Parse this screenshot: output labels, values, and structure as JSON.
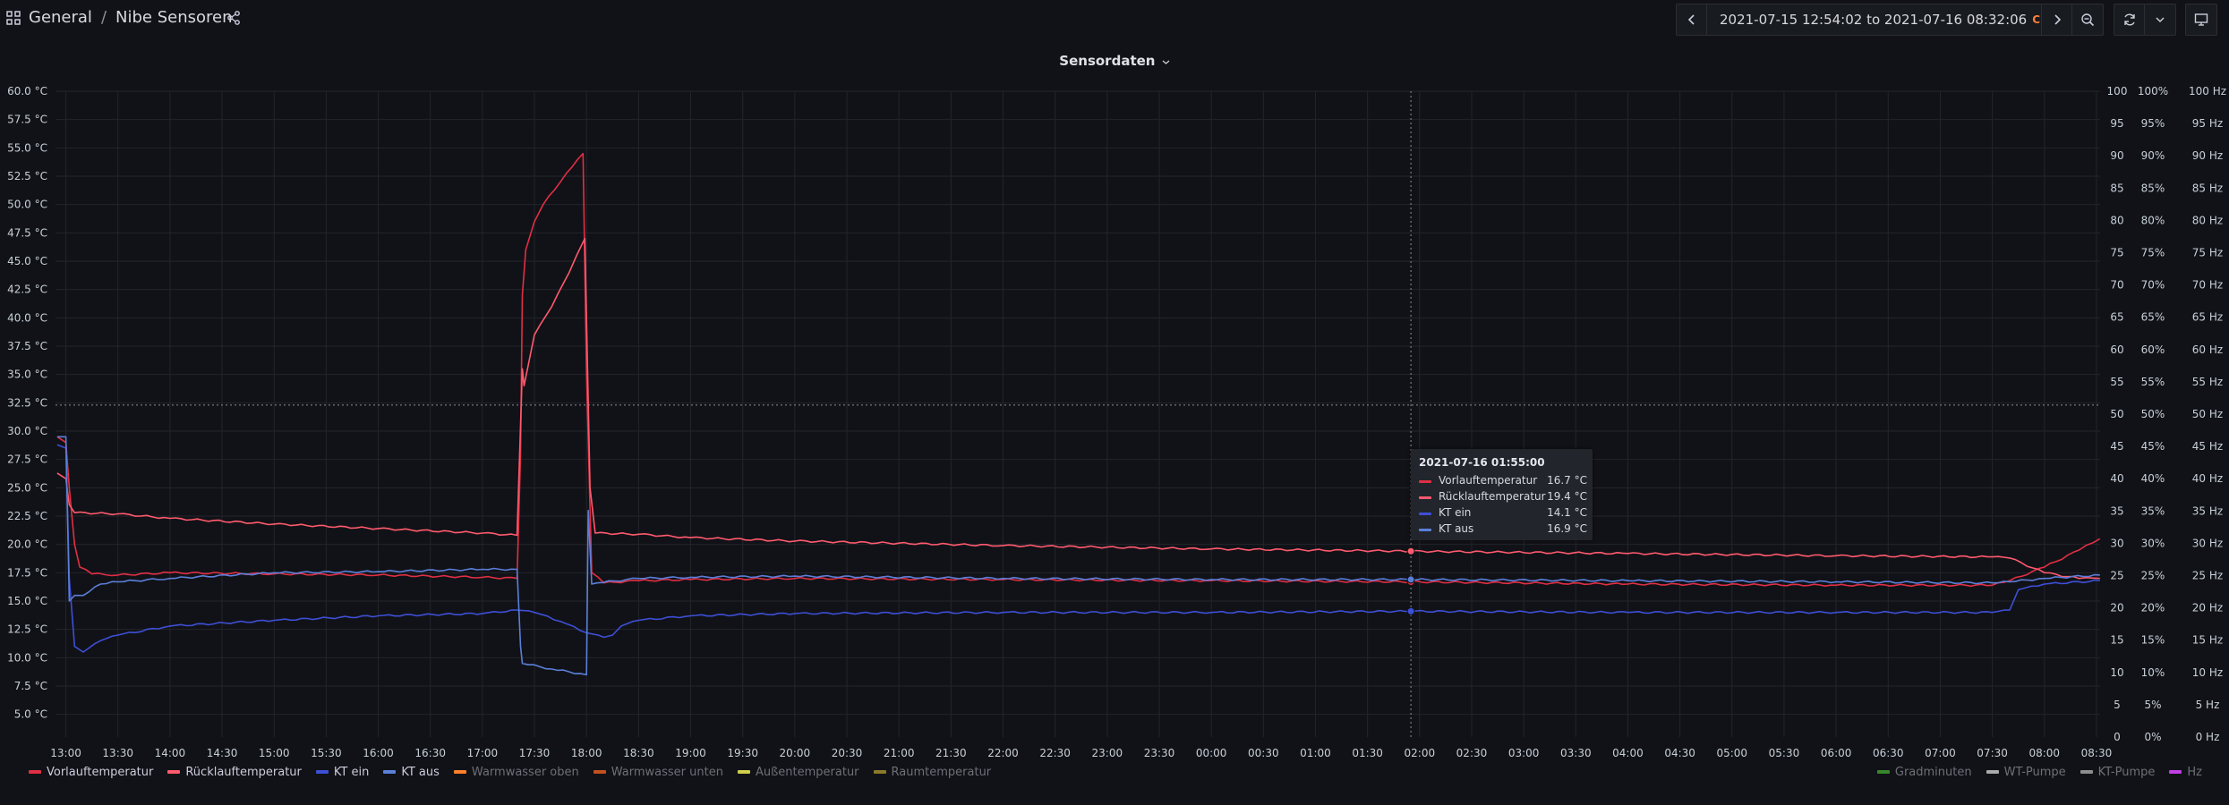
{
  "breadcrumb": {
    "folder": "General",
    "separator": "/",
    "dashboard": "Nibe Sensoren"
  },
  "time_picker": {
    "range": "2021-07-15 12:54:02 to 2021-07-16 08:32:06",
    "timezone": "CEST"
  },
  "panel": {
    "title": "Sensordaten"
  },
  "icons": {
    "apps": "apps-grid-icon",
    "share": "share-icon",
    "prev": "chevron-left-icon",
    "clock": "clock-icon",
    "next": "chevron-right-icon",
    "zoom_out": "zoom-out-icon",
    "refresh": "refresh-icon",
    "refresh_menu": "chevron-down-icon",
    "tv": "tv-mode-icon"
  },
  "tooltip": {
    "time": "2021-07-16 01:55:00",
    "rows": [
      {
        "name": "Vorlauftemperatur",
        "value": "16.7 °C",
        "color": "#e02f44"
      },
      {
        "name": "Rücklauftemperatur",
        "value": "19.4 °C",
        "color": "#ff5a6e"
      },
      {
        "name": "KT ein",
        "value": "14.1 °C",
        "color": "#3d4fd6"
      },
      {
        "name": "KT aus",
        "value": "16.9 °C",
        "color": "#5b7fd9"
      }
    ]
  },
  "legend_left": [
    {
      "name": "Vorlauftemperatur",
      "color": "#e02f44",
      "dim": false
    },
    {
      "name": "Rücklauftemperatur",
      "color": "#ff5a6e",
      "dim": false
    },
    {
      "name": "KT ein",
      "color": "#3d4fd6",
      "dim": false
    },
    {
      "name": "KT aus",
      "color": "#5b7fd9",
      "dim": false
    },
    {
      "name": "Warmwasser oben",
      "color": "#ff7f2a",
      "dim": true
    },
    {
      "name": "Warmwasser unten",
      "color": "#c4501e",
      "dim": true
    },
    {
      "name": "Außentemperatur",
      "color": "#cfcf4a",
      "dim": true
    },
    {
      "name": "Raumtemperatur",
      "color": "#8a7a2a",
      "dim": true
    }
  ],
  "legend_right": [
    {
      "name": "Gradminuten",
      "color": "#37872d",
      "dim": true
    },
    {
      "name": "WT-Pumpe",
      "color": "#aaaaaa",
      "dim": true
    },
    {
      "name": "KT-Pumpe",
      "color": "#8e8e8e",
      "dim": true
    },
    {
      "name": "Hz",
      "color": "#c23ee6",
      "dim": true
    }
  ],
  "chart_data": {
    "type": "line",
    "grid": true,
    "x_ticks": [
      "13:00",
      "13:30",
      "14:00",
      "14:30",
      "15:00",
      "15:30",
      "16:00",
      "16:30",
      "17:00",
      "17:30",
      "18:00",
      "18:30",
      "19:00",
      "19:30",
      "20:00",
      "20:30",
      "21:00",
      "21:30",
      "22:00",
      "22:30",
      "23:00",
      "23:30",
      "00:00",
      "00:30",
      "01:00",
      "01:30",
      "02:00",
      "02:30",
      "03:00",
      "03:30",
      "04:00",
      "04:30",
      "05:00",
      "05:30",
      "06:00",
      "06:30",
      "07:00",
      "07:30",
      "08:00",
      "08:30"
    ],
    "x_range": [
      "2021-07-15 12:54:02",
      "2021-07-16 08:32:06"
    ],
    "y_left": {
      "unit": "°C",
      "range": [
        3,
        60
      ],
      "ticks": [
        "60.0 °C",
        "57.5 °C",
        "55.0 °C",
        "52.5 °C",
        "50.0 °C",
        "47.5 °C",
        "45.0 °C",
        "42.5 °C",
        "40.0 °C",
        "37.5 °C",
        "35.0 °C",
        "32.5 °C",
        "30.0 °C",
        "27.5 °C",
        "25.0 °C",
        "22.5 °C",
        "20.0 °C",
        "17.5 °C",
        "15.0 °C",
        "12.5 °C",
        "10.0 °C",
        "7.5 °C",
        "5.0 °C"
      ]
    },
    "y_right_axes": [
      {
        "ticks": [
          "100",
          "95",
          "90",
          "85",
          "80",
          "75",
          "70",
          "65",
          "60",
          "55",
          "50",
          "45",
          "40",
          "35",
          "30",
          "25",
          "20",
          "15",
          "10",
          "5",
          "0"
        ]
      },
      {
        "ticks": [
          "100%",
          "95%",
          "90%",
          "85%",
          "80%",
          "75%",
          "70%",
          "65%",
          "60%",
          "55%",
          "50%",
          "45%",
          "40%",
          "35%",
          "30%",
          "25%",
          "20%",
          "15%",
          "10%",
          "5%",
          "0%"
        ]
      },
      {
        "ticks": [
          "100 Hz",
          "95 Hz",
          "90 Hz",
          "85 Hz",
          "80 Hz",
          "75 Hz",
          "70 Hz",
          "65 Hz",
          "60 Hz",
          "55 Hz",
          "50 Hz",
          "45 Hz",
          "40 Hz",
          "35 Hz",
          "30 Hz",
          "25 Hz",
          "20 Hz",
          "15 Hz",
          "10 Hz",
          "5 Hz",
          "0 Hz"
        ]
      }
    ],
    "series": [
      {
        "name": "Vorlauftemperatur",
        "color": "#e02f44",
        "x": [
          "2021-07-15 12:55",
          "2021-07-15 13:00",
          "2021-07-15 13:02",
          "2021-07-15 13:05",
          "2021-07-15 13:08",
          "2021-07-15 13:15",
          "2021-07-15 13:30",
          "2021-07-15 14:00",
          "2021-07-15 15:00",
          "2021-07-15 16:00",
          "2021-07-15 17:00",
          "2021-07-15 17:20",
          "2021-07-15 17:22",
          "2021-07-15 17:23",
          "2021-07-15 17:25",
          "2021-07-15 17:30",
          "2021-07-15 17:35",
          "2021-07-15 17:45",
          "2021-07-15 17:55",
          "2021-07-15 17:58",
          "2021-07-15 18:00",
          "2021-07-15 18:03",
          "2021-07-15 18:10",
          "2021-07-15 18:30",
          "2021-07-15 19:00",
          "2021-07-15 20:00",
          "2021-07-15 22:00",
          "2021-07-16 00:00",
          "2021-07-16 01:55",
          "2021-07-16 04:00",
          "2021-07-16 06:00",
          "2021-07-16 07:30",
          "2021-07-16 07:40",
          "2021-07-16 08:00",
          "2021-07-16 08:20",
          "2021-07-16 08:32"
        ],
        "y": [
          29.5,
          29.0,
          25.0,
          20.0,
          18.0,
          17.4,
          17.3,
          17.5,
          17.4,
          17.3,
          17.1,
          17.0,
          28.0,
          42.0,
          46.0,
          48.5,
          50.0,
          52.0,
          54.0,
          54.5,
          35.0,
          17.5,
          16.6,
          16.8,
          16.9,
          17.0,
          16.9,
          16.8,
          16.7,
          16.5,
          16.4,
          16.4,
          16.8,
          18.0,
          19.5,
          20.5
        ]
      },
      {
        "name": "Rücklauftemperatur",
        "color": "#ff5a6e",
        "x": [
          "2021-07-15 12:55",
          "2021-07-15 13:00",
          "2021-07-15 13:02",
          "2021-07-15 13:05",
          "2021-07-15 13:30",
          "2021-07-15 14:00",
          "2021-07-15 15:00",
          "2021-07-15 16:00",
          "2021-07-15 17:00",
          "2021-07-15 17:20",
          "2021-07-15 17:23",
          "2021-07-15 17:24",
          "2021-07-15 17:30",
          "2021-07-15 17:40",
          "2021-07-15 17:50",
          "2021-07-15 17:59",
          "2021-07-15 18:02",
          "2021-07-15 18:05",
          "2021-07-15 18:30",
          "2021-07-15 19:00",
          "2021-07-15 20:00",
          "2021-07-15 22:00",
          "2021-07-16 00:00",
          "2021-07-16 01:55",
          "2021-07-16 04:00",
          "2021-07-16 06:00",
          "2021-07-16 07:30",
          "2021-07-16 07:40",
          "2021-07-16 08:00",
          "2021-07-16 08:20",
          "2021-07-16 08:32"
        ],
        "y": [
          26.3,
          25.8,
          23.5,
          22.8,
          22.7,
          22.3,
          21.8,
          21.4,
          21.0,
          20.8,
          35.5,
          34.0,
          38.5,
          41.0,
          44.0,
          47.0,
          25.0,
          21.0,
          20.9,
          20.6,
          20.3,
          19.9,
          19.6,
          19.4,
          19.2,
          19.0,
          18.9,
          18.8,
          17.5,
          17.0,
          17.0
        ]
      },
      {
        "name": "KT ein",
        "color": "#3d4fd6",
        "x": [
          "2021-07-15 12:55",
          "2021-07-15 13:00",
          "2021-07-15 13:02",
          "2021-07-15 13:05",
          "2021-07-15 13:10",
          "2021-07-15 13:20",
          "2021-07-15 13:30",
          "2021-07-15 14:00",
          "2021-07-15 15:00",
          "2021-07-15 16:00",
          "2021-07-15 17:00",
          "2021-07-15 17:20",
          "2021-07-15 17:30",
          "2021-07-15 17:45",
          "2021-07-15 18:00",
          "2021-07-15 18:10",
          "2021-07-15 18:15",
          "2021-07-15 18:20",
          "2021-07-15 18:30",
          "2021-07-15 19:00",
          "2021-07-15 20:00",
          "2021-07-15 22:00",
          "2021-07-16 00:00",
          "2021-07-16 01:55",
          "2021-07-16 04:00",
          "2021-07-16 06:00",
          "2021-07-16 07:30",
          "2021-07-16 07:40",
          "2021-07-16 07:45",
          "2021-07-16 08:00",
          "2021-07-16 08:32"
        ],
        "y": [
          28.8,
          28.5,
          17.0,
          11.0,
          10.5,
          11.5,
          12.0,
          12.8,
          13.3,
          13.7,
          13.9,
          14.2,
          14.0,
          13.2,
          12.2,
          11.8,
          12.0,
          12.8,
          13.3,
          13.7,
          13.9,
          14.0,
          14.0,
          14.1,
          14.0,
          14.0,
          14.0,
          14.2,
          16.0,
          16.5,
          16.8
        ]
      },
      {
        "name": "KT aus",
        "color": "#5b7fd9",
        "x": [
          "2021-07-15 12:55",
          "2021-07-15 13:00",
          "2021-07-15 13:02",
          "2021-07-15 13:05",
          "2021-07-15 13:10",
          "2021-07-15 13:20",
          "2021-07-15 13:30",
          "2021-07-15 14:00",
          "2021-07-15 15:00",
          "2021-07-15 16:00",
          "2021-07-15 17:00",
          "2021-07-15 17:20",
          "2021-07-15 17:22",
          "2021-07-15 17:23",
          "2021-07-15 17:40",
          "2021-07-15 18:00",
          "2021-07-15 18:01",
          "2021-07-15 18:03",
          "2021-07-15 18:06",
          "2021-07-15 18:30",
          "2021-07-15 19:00",
          "2021-07-15 20:00",
          "2021-07-15 22:00",
          "2021-07-16 00:00",
          "2021-07-16 01:55",
          "2021-07-16 04:00",
          "2021-07-16 06:00",
          "2021-07-16 07:30",
          "2021-07-16 07:40",
          "2021-07-16 08:00",
          "2021-07-16 08:32"
        ],
        "y": [
          29.5,
          29.5,
          15.0,
          15.5,
          15.5,
          16.5,
          16.7,
          17.0,
          17.5,
          17.6,
          17.8,
          17.8,
          11.0,
          9.5,
          9.0,
          8.5,
          23.0,
          16.5,
          16.6,
          17.0,
          17.1,
          17.2,
          17.0,
          16.9,
          16.9,
          16.8,
          16.7,
          16.6,
          16.7,
          17.0,
          17.3
        ]
      }
    ],
    "crosshair_x": "2021-07-16 01:55:00"
  }
}
